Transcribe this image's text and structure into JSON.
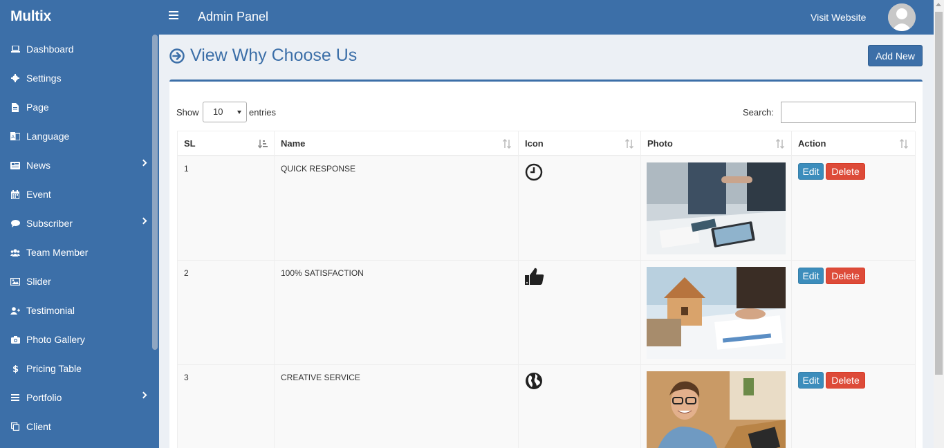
{
  "header": {
    "brand": "Multix",
    "title": "Admin Panel",
    "visit_label": "Visit Website"
  },
  "sidebar": {
    "items": [
      {
        "label": "Dashboard",
        "icon": "laptop-icon",
        "has_submenu": false
      },
      {
        "label": "Settings",
        "icon": "gear-icon",
        "has_submenu": false
      },
      {
        "label": "Page",
        "icon": "file-icon",
        "has_submenu": false
      },
      {
        "label": "Language",
        "icon": "language-icon",
        "has_submenu": false
      },
      {
        "label": "News",
        "icon": "newspaper-icon",
        "has_submenu": true
      },
      {
        "label": "Event",
        "icon": "calendar-icon",
        "has_submenu": false
      },
      {
        "label": "Subscriber",
        "icon": "comment-icon",
        "has_submenu": true
      },
      {
        "label": "Team Member",
        "icon": "users-icon",
        "has_submenu": false
      },
      {
        "label": "Slider",
        "icon": "image-icon",
        "has_submenu": false
      },
      {
        "label": "Testimonial",
        "icon": "user-plus-icon",
        "has_submenu": false
      },
      {
        "label": "Photo Gallery",
        "icon": "camera-icon",
        "has_submenu": false
      },
      {
        "label": "Pricing Table",
        "icon": "dollar-icon",
        "has_submenu": false
      },
      {
        "label": "Portfolio",
        "icon": "bars-icon",
        "has_submenu": true
      },
      {
        "label": "Client",
        "icon": "copy-icon",
        "has_submenu": false
      }
    ]
  },
  "page": {
    "heading": "View Why Choose Us",
    "add_new_label": "Add New"
  },
  "table_controls": {
    "show_label": "Show",
    "entries_value": "10",
    "entries_label": "entries",
    "search_label": "Search:",
    "search_value": ""
  },
  "table": {
    "columns": [
      "SL",
      "Name",
      "Icon",
      "Photo",
      "Action"
    ],
    "rows": [
      {
        "sl": "1",
        "name": "QUICK RESPONSE",
        "icon": "clock-icon",
        "photo": "handshake-photo",
        "edit_label": "Edit",
        "delete_label": "Delete"
      },
      {
        "sl": "2",
        "name": "100% SATISFACTION",
        "icon": "thumbs-up-icon",
        "photo": "house-model-photo",
        "edit_label": "Edit",
        "delete_label": "Delete"
      },
      {
        "sl": "3",
        "name": "CREATIVE SERVICE",
        "icon": "globe-icon",
        "photo": "smiling-man-photo",
        "edit_label": "Edit",
        "delete_label": "Delete"
      }
    ]
  },
  "colors": {
    "primary": "#3c6fa8",
    "edit_button": "#3c8dbc",
    "delete_button": "#dd4b39",
    "page_bg": "#ecf0f5"
  }
}
